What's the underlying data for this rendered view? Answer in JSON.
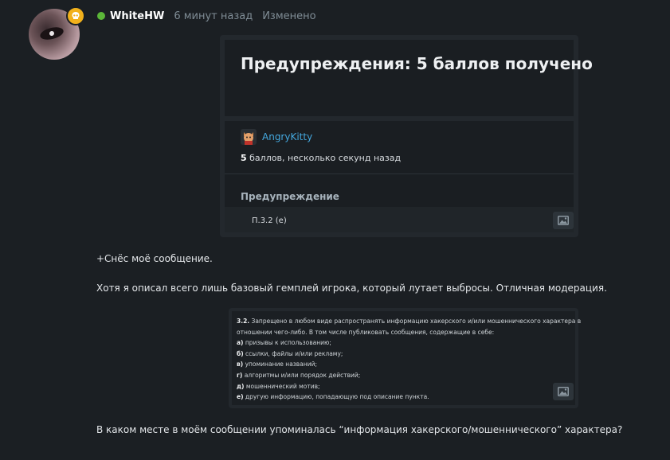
{
  "post": {
    "author": "WhiteHW",
    "time": "6 минут назад",
    "edited_label": "Изменено"
  },
  "warning_card": {
    "title": "Предупреждения: 5 баллов получено",
    "giver": "AngryKitty",
    "points_value": "5",
    "points_text": " баллов, несколько секунд назад",
    "section_label": "Предупреждение",
    "rule": "П.3.2 (е)"
  },
  "body_text": {
    "line1": "+Снёс моё сообщение.",
    "line2": "Хотя я описал всего лишь базовый гемплей игрока, который лутает выбросы. Отличная модерация.",
    "line3": "В каком месте в моём сообщении упоминалась “информация хакерского/мошеннического” характера?"
  },
  "rules_card": {
    "rule_num": "3.2.",
    "lines": [
      " Запрещено в любом виде распространять информацию хакерского и/или мошеннического характера в",
      "отношении чего-либо. В том числе публиковать сообщения, содержащие в себе:"
    ],
    "items": [
      {
        "letter": "а)",
        "text": " призывы к использованию;"
      },
      {
        "letter": "б)",
        "text": " ссылки, файлы и/или рекламу;"
      },
      {
        "letter": "в)",
        "text": " упоминание названий;"
      },
      {
        "letter": "г)",
        "text": " алгоритмы и/или порядок действий;"
      },
      {
        "letter": "д)",
        "text": " мошеннический мотив;"
      },
      {
        "letter": "е)",
        "text": " другую информацию, попадающую под описание пункта."
      }
    ]
  },
  "icons": {
    "badge": "skull-icon",
    "image": "image-icon"
  },
  "colors": {
    "background": "#1b1f23",
    "online": "#5bb638",
    "badge": "#f2b11c",
    "link": "#44a8de"
  }
}
